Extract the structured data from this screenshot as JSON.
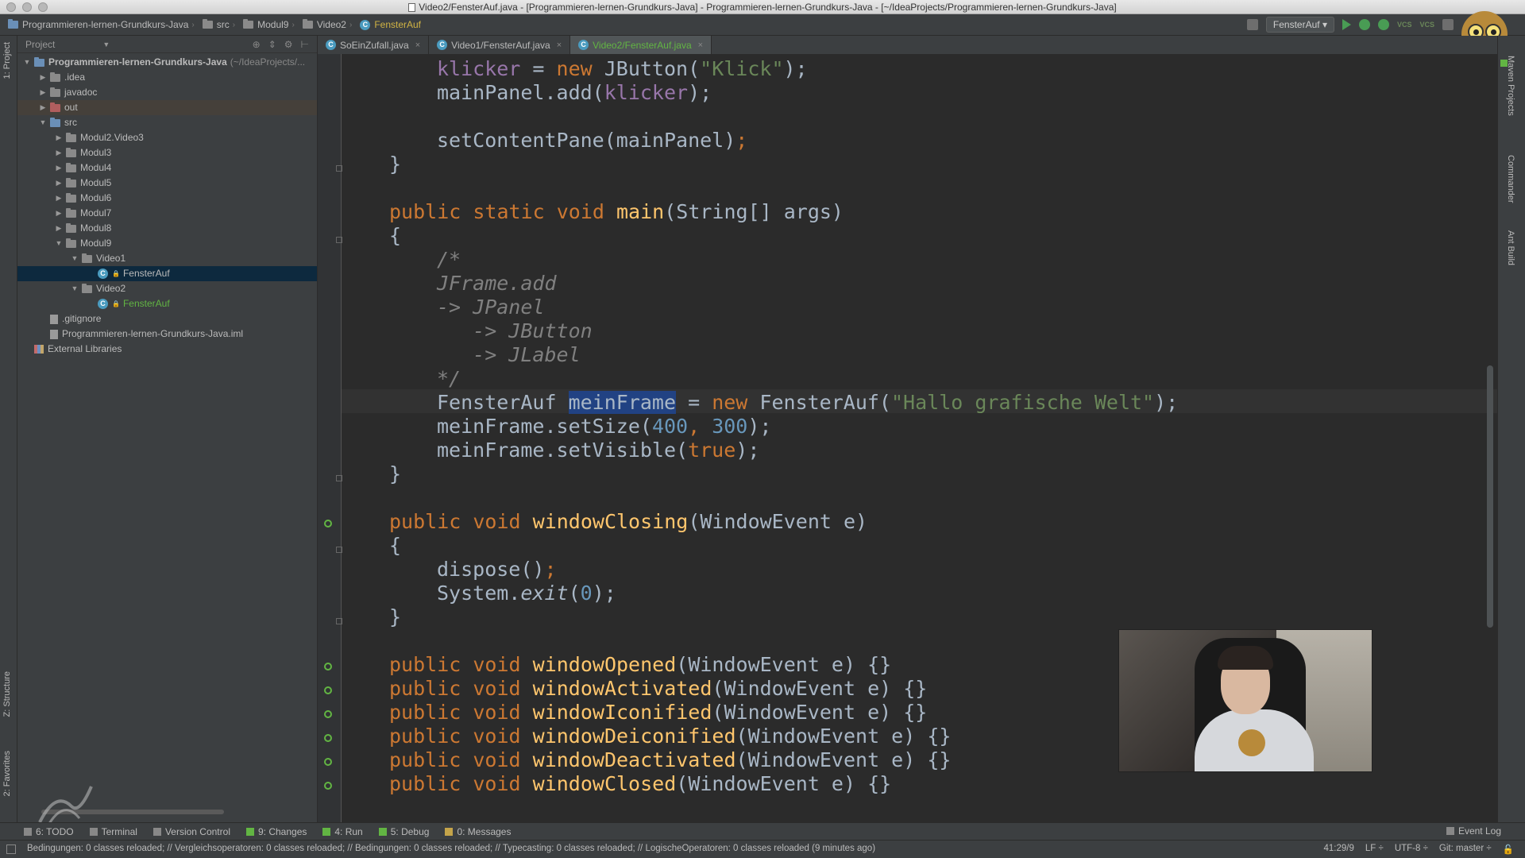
{
  "window": {
    "title": "Video2/FensterAuf.java - [Programmieren-lernen-Grundkurs-Java] - Programmieren-lernen-Grundkurs-Java - [~/IdeaProjects/Programmieren-lernen-Grundkurs-Java]"
  },
  "breadcrumb": [
    "Programmieren-lernen-Grundkurs-Java",
    "src",
    "Modul9",
    "Video2",
    "FensterAuf"
  ],
  "toolbar": {
    "run_config": "FensterAuf",
    "vcs_label": "VCS"
  },
  "left_strip": {
    "project_tab": "1: Project",
    "structure_tab": "Z: Structure",
    "favorites_tab": "2: Favorites"
  },
  "project_panel": {
    "header": "Project",
    "tree": [
      {
        "label": "Programmieren-lernen-Grundkurs-Java",
        "suffix": "(~/IdeaProjects/...",
        "depth": 0,
        "arrow": "▼",
        "icon": "folder-icon"
      },
      {
        "label": ".idea",
        "depth": 1,
        "arrow": "▶",
        "icon": "folder-icon"
      },
      {
        "label": "javadoc",
        "depth": 1,
        "arrow": "▶",
        "icon": "folder-icon"
      },
      {
        "label": "out",
        "depth": 1,
        "arrow": "▶",
        "icon": "folder-icon"
      },
      {
        "label": "src",
        "depth": 1,
        "arrow": "▼",
        "icon": "folder-icon"
      },
      {
        "label": "Modul2.Video3",
        "depth": 2,
        "arrow": "▶",
        "icon": "folder-icon"
      },
      {
        "label": "Modul3",
        "depth": 2,
        "arrow": "▶",
        "icon": "folder-icon"
      },
      {
        "label": "Modul4",
        "depth": 2,
        "arrow": "▶",
        "icon": "folder-icon"
      },
      {
        "label": "Modul5",
        "depth": 2,
        "arrow": "▶",
        "icon": "folder-icon"
      },
      {
        "label": "Modul6",
        "depth": 2,
        "arrow": "▶",
        "icon": "folder-icon"
      },
      {
        "label": "Modul7",
        "depth": 2,
        "arrow": "▶",
        "icon": "folder-icon"
      },
      {
        "label": "Modul8",
        "depth": 2,
        "arrow": "▶",
        "icon": "folder-icon"
      },
      {
        "label": "Modul9",
        "depth": 2,
        "arrow": "▼",
        "icon": "folder-icon"
      },
      {
        "label": "Video1",
        "depth": 3,
        "arrow": "▼",
        "icon": "folder-icon"
      },
      {
        "label": "FensterAuf",
        "depth": 4,
        "arrow": "",
        "icon": "class-icon"
      },
      {
        "label": "Video2",
        "depth": 3,
        "arrow": "▼",
        "icon": "folder-icon"
      },
      {
        "label": "FensterAuf",
        "depth": 4,
        "arrow": "",
        "icon": "class-icon"
      },
      {
        "label": ".gitignore",
        "depth": 1,
        "arrow": "",
        "icon": "file-icon"
      },
      {
        "label": "Programmieren-lernen-Grundkurs-Java.iml",
        "depth": 1,
        "arrow": "",
        "icon": "file-icon"
      },
      {
        "label": "External Libraries",
        "depth": 0,
        "arrow": "",
        "icon": "library-icon"
      }
    ]
  },
  "tabs": [
    {
      "label": "SoEinZufall.java",
      "close": "×"
    },
    {
      "label": "Video1/FensterAuf.java",
      "close": "×"
    },
    {
      "label": "Video2/FensterAuf.java",
      "close": "×"
    }
  ],
  "code": {
    "l1": {
      "a": "klicker",
      "b": " = ",
      "c": "new",
      "d": " JButton(",
      "e": "\"Klick\"",
      "f": ");"
    },
    "l2": {
      "a": "mainPanel.add(",
      "b": "klicker",
      "c": ");"
    },
    "l3": {
      "a": "setContentPane(mainPanel)",
      "b": ";"
    },
    "l4": "}",
    "l5": {
      "a": "public static void",
      "b": " ",
      "c": "main",
      "d": "(String[] args)"
    },
    "l6": "{",
    "c1": "/*",
    "c2": "JFrame.add",
    "c3": "-> JPanel",
    "c4": "   -> JButton",
    "c5": "   -> JLabel",
    "c6": "*/",
    "l7": {
      "a": "FensterAuf ",
      "b": "meinFrame",
      "c": " = ",
      "d": "new",
      "e": " FensterAuf(",
      "f": "\"Hallo grafische Welt\"",
      "g": ");"
    },
    "l8": {
      "a": "meinFrame.setSize(",
      "b": "400",
      "c": ", ",
      "d": "300",
      "e": ");"
    },
    "l9": {
      "a": "meinFrame.setVisible(",
      "b": "true",
      "c": ");"
    },
    "l10": "}",
    "l11": {
      "a": "public void",
      "b": " ",
      "c": "windowClosing",
      "d": "(WindowEvent e)"
    },
    "l12": "{",
    "l13": {
      "a": "dispose()",
      "b": ";"
    },
    "l14": {
      "a": "System.",
      "b": "exit",
      "c": "(",
      "d": "0",
      "e": ");"
    },
    "l15": "}",
    "m1": {
      "a": "public void",
      "b": " ",
      "c": "windowOpened",
      "d": "(WindowEvent e) {}"
    },
    "m2": {
      "a": "public void",
      "b": " ",
      "c": "windowActivated",
      "d": "(WindowEvent e) {}"
    },
    "m3": {
      "a": "public void",
      "b": " ",
      "c": "windowIconified",
      "d": "(WindowEvent e) {}"
    },
    "m4": {
      "a": "public void",
      "b": " ",
      "c": "windowDeiconified",
      "d": "(WindowEvent e) {}"
    },
    "m5": {
      "a": "public void",
      "b": " ",
      "c": "windowDeactivated",
      "d": "(WindowEvent e) {}"
    },
    "m6": {
      "a": "public void",
      "b": " ",
      "c": "windowClosed",
      "d": "(WindowEvent e) {}"
    }
  },
  "right_strip": {
    "maven": "Maven Projects",
    "commander": "Commander",
    "ant": "Ant Build"
  },
  "bottom_tools": {
    "todo": "6: TODO",
    "terminal": "Terminal",
    "vcs": "Version Control",
    "changes": "9: Changes",
    "run": "4: Run",
    "debug": "5: Debug",
    "messages": "0: Messages",
    "event_log": "Event Log"
  },
  "status": {
    "message": "Bedingungen: 0 classes reloaded; // Vergleichsoperatoren: 0 classes reloaded; // Bedingungen: 0 classes reloaded; // Typecasting: 0 classes reloaded; // LogischeOperatoren: 0 classes reloaded (9 minutes ago)",
    "position": "41:29/9",
    "line_sep": "LF ÷",
    "encoding": "UTF-8 ÷",
    "git": "Git: master ÷"
  },
  "colors": {
    "keyword": "#cc7832",
    "method": "#ffc66d",
    "string": "#6a8759",
    "number": "#6897bb",
    "field": "#9876aa",
    "comment": "#808080",
    "selection": "#214283"
  }
}
